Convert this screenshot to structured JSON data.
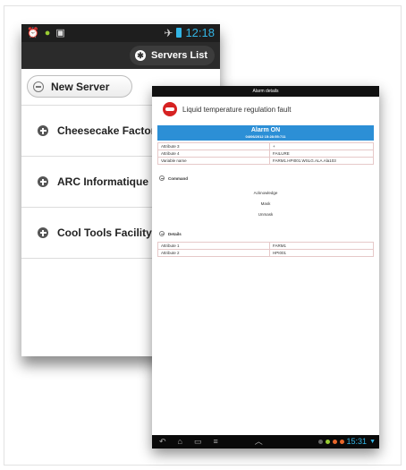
{
  "phone": {
    "status_time": "12:18",
    "servers_list_label": "Servers List",
    "new_server_label": "New Server",
    "servers": [
      {
        "name": "Cheesecake Factory"
      },
      {
        "name": "ARC Informatique buil"
      },
      {
        "name": "Cool Tools Facility"
      }
    ]
  },
  "tablet": {
    "header_title": "Alarm details",
    "alarm_title": "Liquid temperature regulation fault",
    "alarm_state": "Alarm ON",
    "alarm_timestamp": "04/06/2012 15:28:55:711",
    "attributes": [
      {
        "label": "Attribute 3",
        "value": "+"
      },
      {
        "label": "Attribute 4",
        "value": "FAILURE"
      },
      {
        "label": "Variable name",
        "value": "FARM1.HPI001.WSLG.ALA.Ala103"
      }
    ],
    "command_section": "Command",
    "commands": [
      "Acknowledge",
      "Mask",
      "Unmask"
    ],
    "details_section": "Details",
    "details": [
      {
        "label": "Attribute 1",
        "value": "FARM1"
      },
      {
        "label": "Attribute 2",
        "value": "HPI001"
      }
    ],
    "nav_time": "15:31"
  },
  "colors": {
    "accent": "#33b5e5",
    "alarm_bar": "#2c8fd6",
    "logo_red": "#d62222"
  }
}
